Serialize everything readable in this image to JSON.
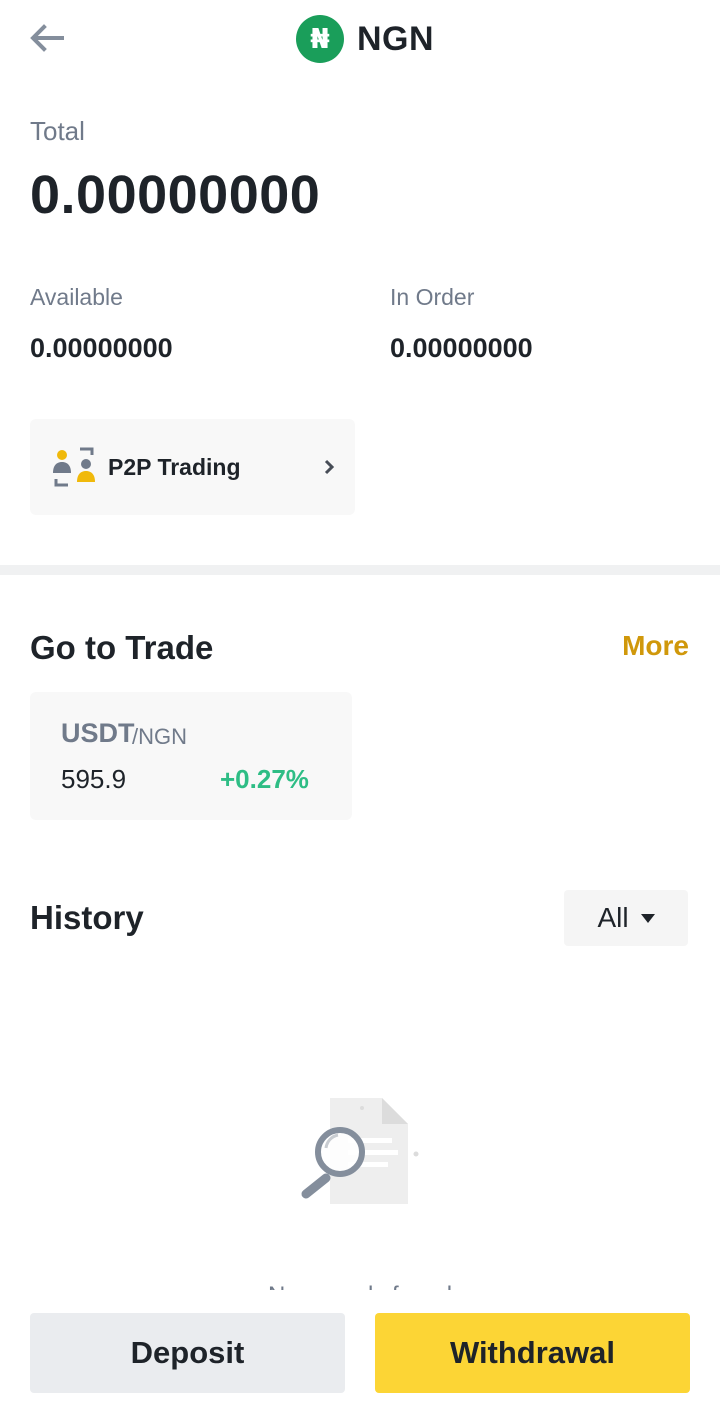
{
  "header": {
    "back_icon": "arrow-left-icon",
    "coin_icon": "naira-icon",
    "coin_symbol": "₦",
    "title": "NGN",
    "brand_green": "#1a9e5a"
  },
  "balance": {
    "total_label": "Total",
    "total_value": "0.00000000",
    "available_label": "Available",
    "available_value": "0.00000000",
    "in_order_label": "In Order",
    "in_order_value": "0.00000000"
  },
  "p2p": {
    "icon": "p2p-trading-icon",
    "label": "P2P Trading",
    "chevron_icon": "chevron-right-icon"
  },
  "trade": {
    "title": "Go to Trade",
    "more_label": "More",
    "pair": {
      "base": "USDT",
      "quote": "/NGN",
      "price": "595.9",
      "change": "+0.27%"
    }
  },
  "history": {
    "title": "History",
    "filter_label": "All",
    "empty_icon": "no-records-search-icon",
    "empty_text": "No records found"
  },
  "actions": {
    "deposit_label": "Deposit",
    "withdrawal_label": "Withdrawal"
  },
  "colors": {
    "accent_yellow": "#fcd535",
    "more_gold": "#d0980b",
    "positive_green": "#2ebd85"
  }
}
